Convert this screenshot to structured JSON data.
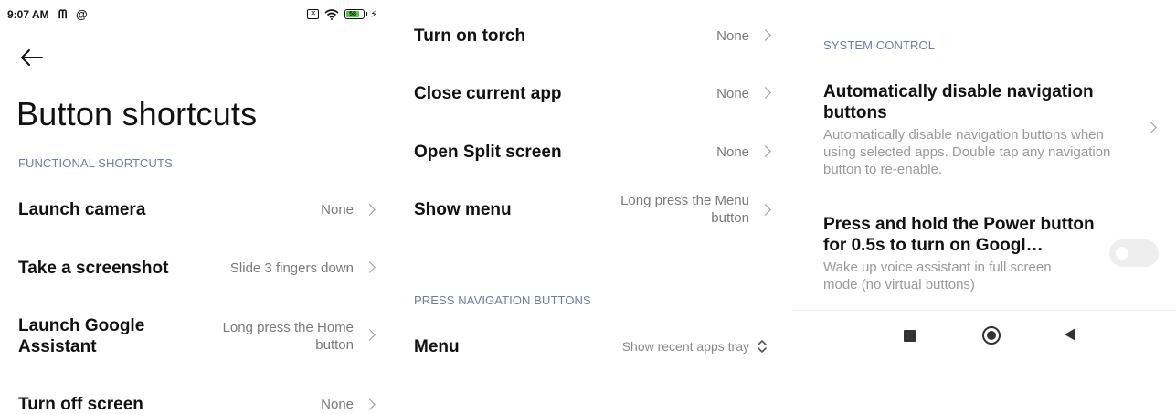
{
  "status_bar": {
    "time": "9:07 AM",
    "battery": "58"
  },
  "screen_title": "Button shortcuts",
  "functional_shortcuts": {
    "header": "FUNCTIONAL SHORTCUTS",
    "items": [
      {
        "label": "Launch camera",
        "value": "None"
      },
      {
        "label": "Take a screenshot",
        "value": "Slide 3 fingers down"
      },
      {
        "label": "Launch Google Assistant",
        "value": "Long press the Home button"
      },
      {
        "label": "Turn off screen",
        "value": "None"
      },
      {
        "label": "Turn on torch",
        "value": "None"
      },
      {
        "label": "Close current app",
        "value": "None"
      },
      {
        "label": "Open Split screen",
        "value": "None"
      },
      {
        "label": "Show menu",
        "value": "Long press the Menu button"
      }
    ]
  },
  "navigation_buttons": {
    "header": "PRESS NAVIGATION BUTTONS",
    "menu_label": "Menu",
    "menu_value": "Show recent apps tray"
  },
  "system_control": {
    "header": "SYSTEM CONTROL",
    "auto_disable_title": "Automatically disable navigation buttons",
    "auto_disable_desc": "Automatically disable navigation buttons when using selected apps. Double tap any navigation button to re-enable.",
    "power_hold_title": "Press and hold the Power button for 0.5s to turn on Googl…",
    "power_hold_desc": "Wake up voice assistant in full screen mode (no virtual buttons)",
    "power_hold_enabled": false
  },
  "icons": {
    "back": "back-arrow-icon",
    "chevron": "chevron-right-icon",
    "updown": "up-down-chevron-icon",
    "nav_recents": "recents-square-icon",
    "nav_home": "home-circle-icon",
    "nav_back": "back-triangle-icon"
  },
  "colors": {
    "section_header": "#6b7ea6",
    "secondary_text": "#7a7a7a",
    "battery_fill": "#4ccd3a"
  }
}
